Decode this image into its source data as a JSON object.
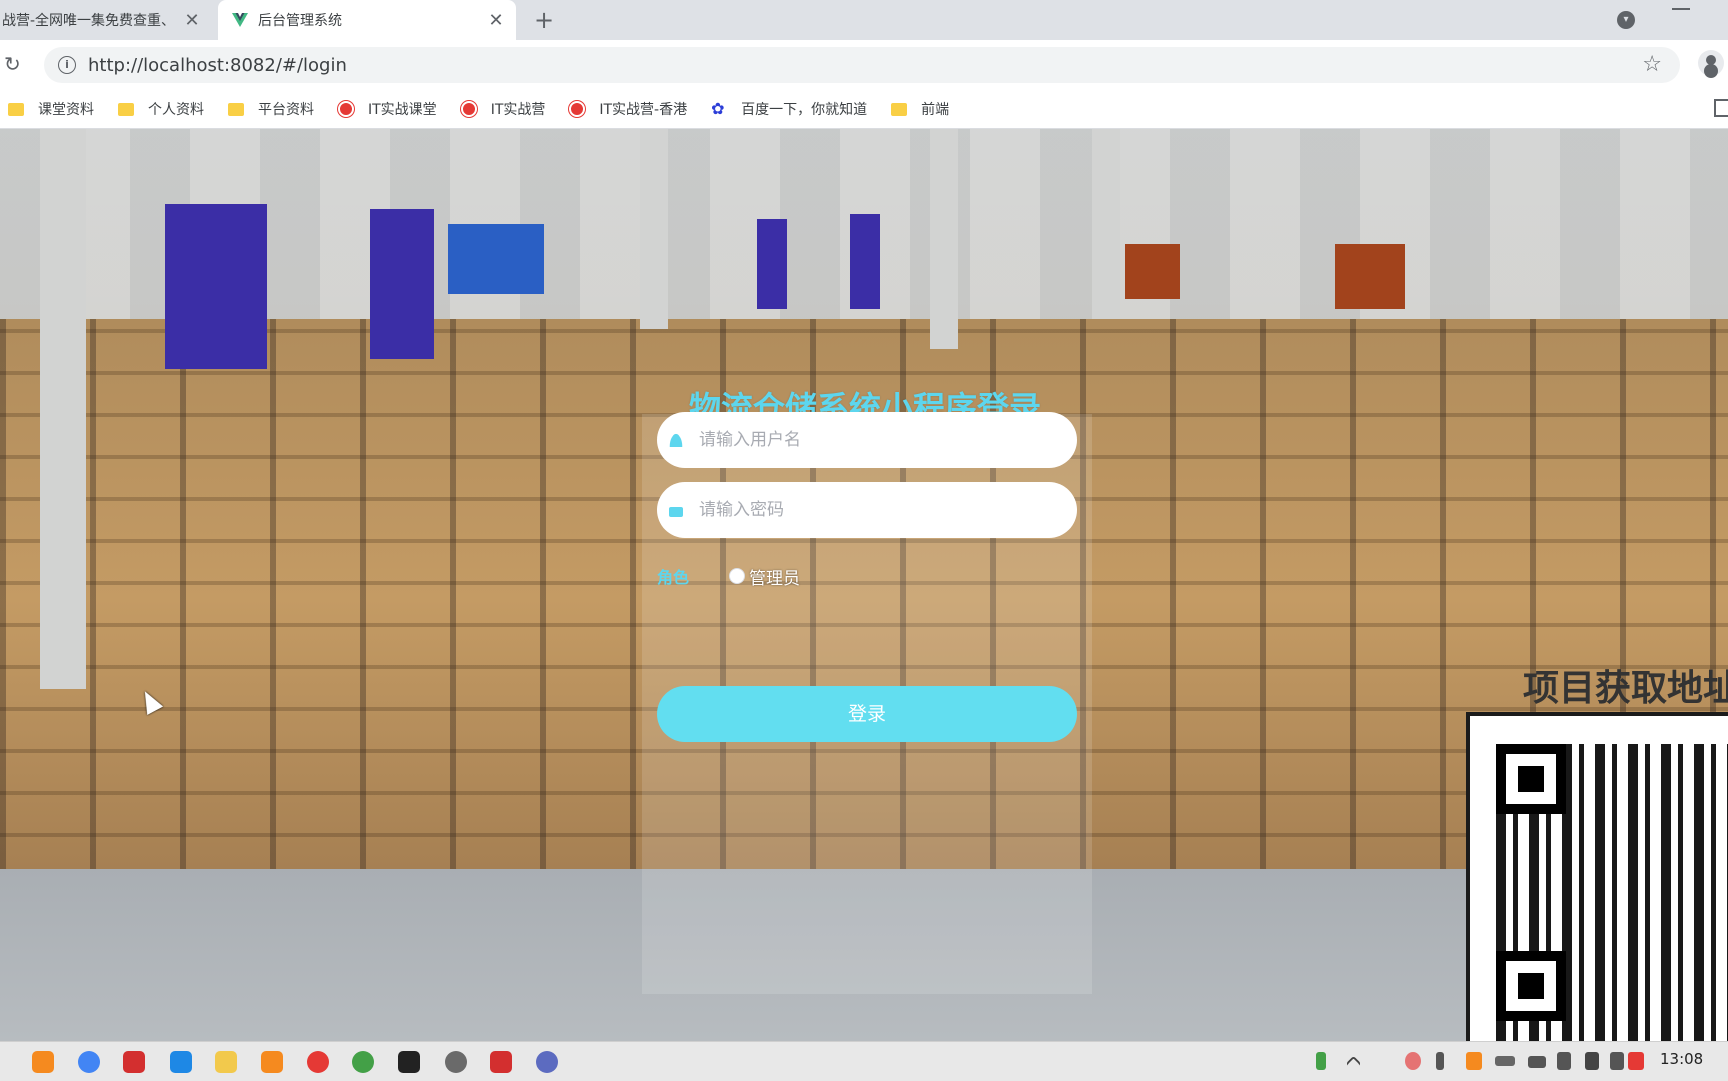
{
  "browser": {
    "tabs": [
      {
        "title": "战营-全网唯一集免费查重、",
        "active": false
      },
      {
        "title": "后台管理系统",
        "active": true
      }
    ],
    "new_tab": "+",
    "url": "http://localhost:8082/#/login",
    "bookmarks": [
      {
        "label": "课堂资料",
        "icon": "folder-icon"
      },
      {
        "label": "个人资料",
        "icon": "folder-icon"
      },
      {
        "label": "平台资料",
        "icon": "folder-icon"
      },
      {
        "label": "IT实战课堂",
        "icon": "site-icon"
      },
      {
        "label": "IT实战营",
        "icon": "site-icon"
      },
      {
        "label": "IT实战营-香港",
        "icon": "site-icon"
      },
      {
        "label": "百度一下，你就知道",
        "icon": "baidu-paw-icon"
      },
      {
        "label": "前端",
        "icon": "folder-icon"
      }
    ]
  },
  "login": {
    "title": "物流仓储系统小程序登录",
    "username_placeholder": "请输入用户名",
    "password_placeholder": "请输入密码",
    "role_label": "角色",
    "role_option": "管理员",
    "submit": "登录",
    "accent": "#5dd6ee"
  },
  "promo": {
    "text": "项目获取地址"
  },
  "taskbar": {
    "time": "13:08"
  }
}
